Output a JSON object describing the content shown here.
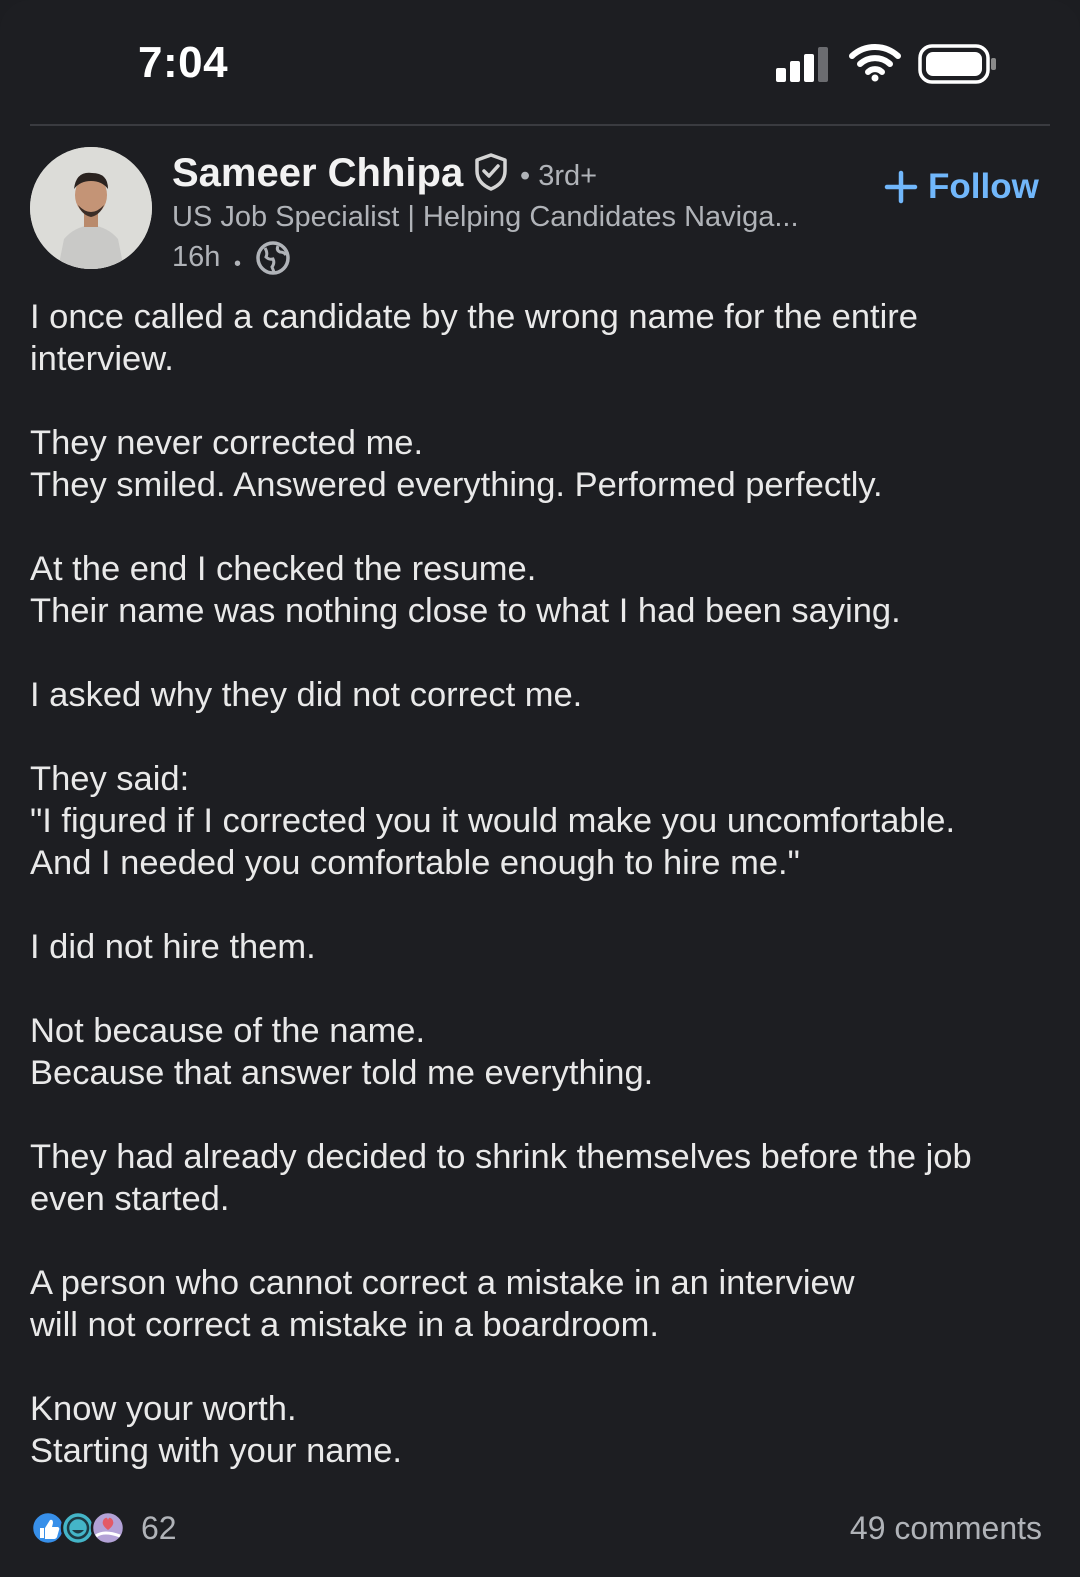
{
  "status_bar": {
    "time": "7:04",
    "icons": [
      "signal-icon",
      "wifi-icon",
      "battery-icon"
    ]
  },
  "post": {
    "author": {
      "name": "Sameer Chhipa",
      "degree": "• 3rd+",
      "headline": "US Job Specialist | Helping Candidates Naviga...",
      "age": "16h",
      "visibility_icon": "globe-icon",
      "verified_icon": "verified-shield-icon"
    },
    "follow_label": "Follow",
    "paragraphs": [
      [
        "I once called a candidate by the wrong name for the entire",
        "interview."
      ],
      [
        "They never corrected me.",
        "They smiled. Answered everything. Performed perfectly."
      ],
      [
        "At the end I checked the resume.",
        "Their name was nothing close to what I had been saying."
      ],
      [
        "I asked why they did not correct me."
      ],
      [
        "They said:",
        "\"I figured if I corrected you it would make you uncomfortable.",
        "And I needed you comfortable enough to hire me.\""
      ],
      [
        "I did not hire them."
      ],
      [
        "Not because of the name.",
        "Because that answer told me everything."
      ],
      [
        "They had already decided to shrink themselves before the job",
        "even started."
      ],
      [
        "A person who cannot correct a mistake in an interview",
        "will not correct a mistake in a boardroom."
      ],
      [
        "Know your worth.",
        "Starting with your name."
      ]
    ],
    "reaction_icons": [
      "like-icon",
      "funny-icon",
      "support-icon"
    ],
    "reaction_count": "62",
    "comments": "49 comments"
  },
  "colors": {
    "background": "#1d1e22",
    "accent": "#71b7fb",
    "secondary_text": "#b0b3b8",
    "primary_text": "#e9e9e9"
  }
}
